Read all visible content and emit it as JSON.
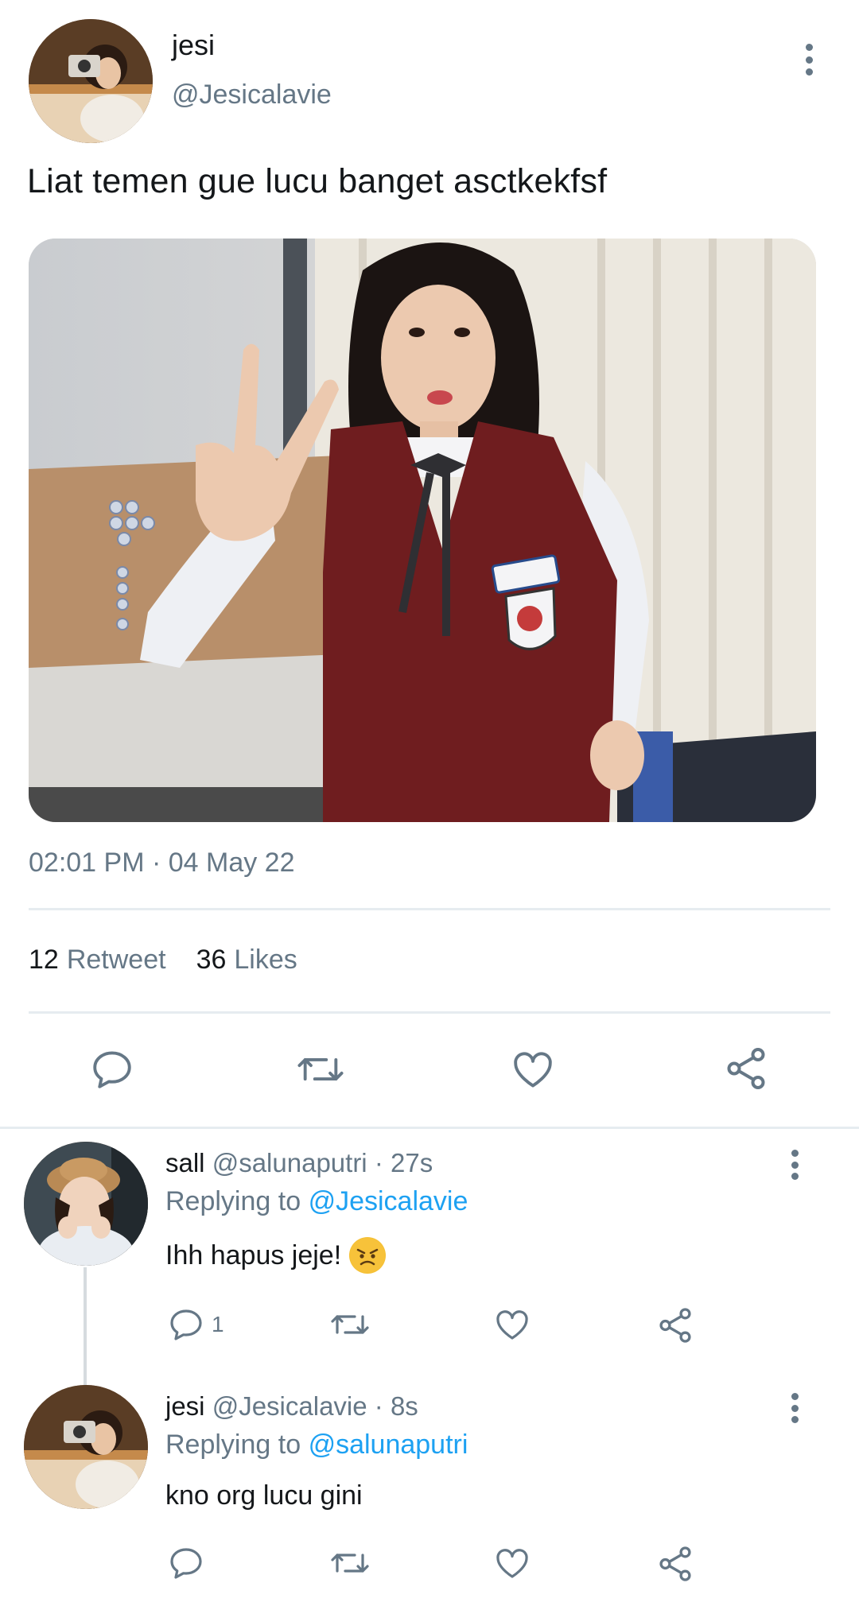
{
  "main_tweet": {
    "avatar_icon": "profile-photo-jesi",
    "display_name": "jesi",
    "handle": "@Jesicalavie",
    "text": "Liat temen gue lucu banget asctkekfsf",
    "media": "photo-girl-school-uniform-peace-sign",
    "timestamp": "02:01 PM · 04 May 22",
    "retweet_count": "12",
    "retweet_label": "Retweet",
    "likes_count": "36",
    "likes_label": "Likes",
    "actions": [
      "reply-icon",
      "retweet-icon",
      "like-icon",
      "share-icon"
    ]
  },
  "replies": [
    {
      "avatar_icon": "profile-photo-sall",
      "display_name": "sall",
      "handle": "@salunaputri",
      "time": "· 27s",
      "replying_label": "Replying to",
      "replying_to": "@Jesicalavie",
      "text": "Ihh hapus jeje!",
      "emoji": "angry-face-emoji",
      "reply_count": "1"
    },
    {
      "avatar_icon": "profile-photo-jesi",
      "display_name": "jesi",
      "handle": "@Jesicalavie",
      "time": "· 8s",
      "replying_label": "Replying to",
      "replying_to": "@salunaputri",
      "text": "kno org lucu gini",
      "reply_count": ""
    }
  ],
  "colors": {
    "text": "#14171a",
    "muted": "#657786",
    "link": "#1da1f2",
    "divider": "#e6ecf0"
  }
}
